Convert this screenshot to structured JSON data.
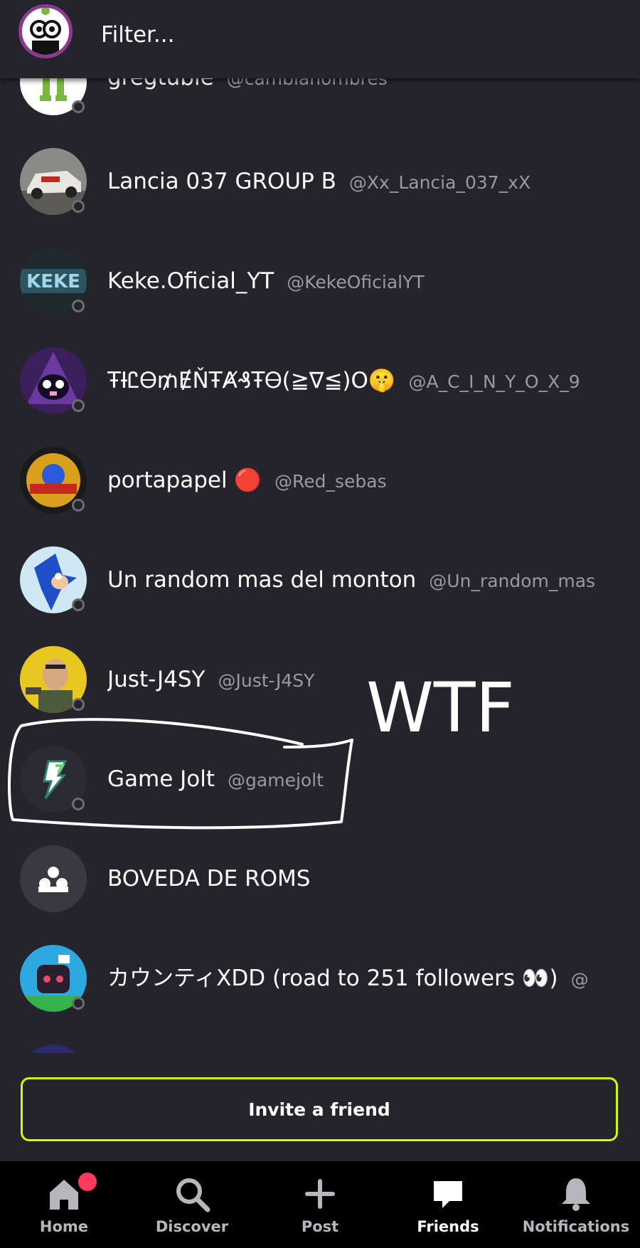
{
  "header": {
    "filter_placeholder": "Filter..."
  },
  "friends": [
    {
      "name": "gregtuble",
      "handle": "@cambianombres",
      "avatar": "alien-figure-avatar"
    },
    {
      "name": "Lancia 037 GROUP B",
      "handle": "@Xx_Lancia_037_xX",
      "avatar": "rally-car-avatar"
    },
    {
      "name": "Keke.Oficial_YT",
      "handle": "@KekeOficialYT",
      "avatar": "keke-logo-avatar"
    },
    {
      "name": "ŦƗᏝᎾ₥ɆŇŦȺ₰ŦᎾ(≧∇≦)O🤫",
      "handle": "@A_C_I_N_Y_O_X_9",
      "avatar": "purple-hood-avatar"
    },
    {
      "name": "portapapel 🔴",
      "handle": "@Red_sebas",
      "avatar": "sonic-badge-avatar"
    },
    {
      "name": "Un random mas del monton",
      "handle": "@Un_random_mas",
      "avatar": "sonic-avatar"
    },
    {
      "name": "Just-J4SY",
      "handle": "@Just-J4SY",
      "avatar": "bald-man-avatar"
    },
    {
      "name": "Game Jolt",
      "handle": "@gamejolt",
      "avatar": "gamejolt-bolt-avatar"
    },
    {
      "name": "BOVEDA DE ROMS",
      "handle": "",
      "avatar": "group-icon-avatar"
    },
    {
      "name": "カウンティXDD (road to 251 followers 👀)",
      "handle": "@",
      "avatar": "robot-avatar"
    }
  ],
  "annotation": {
    "text": "WTF"
  },
  "invite": {
    "label": "Invite a friend"
  },
  "nav": [
    {
      "label": "Home",
      "icon": "home-icon",
      "active": false,
      "badge": true
    },
    {
      "label": "Discover",
      "icon": "search-icon",
      "active": false
    },
    {
      "label": "Post",
      "icon": "plus-icon",
      "active": false
    },
    {
      "label": "Friends",
      "icon": "chat-bubble-icon",
      "active": true
    },
    {
      "label": "Notifications",
      "icon": "bell-icon",
      "active": false
    }
  ],
  "colors": {
    "background": "#25242c",
    "accent": "#ccff00",
    "notification_badge": "#ff3a5c",
    "nav_background": "#000000"
  }
}
